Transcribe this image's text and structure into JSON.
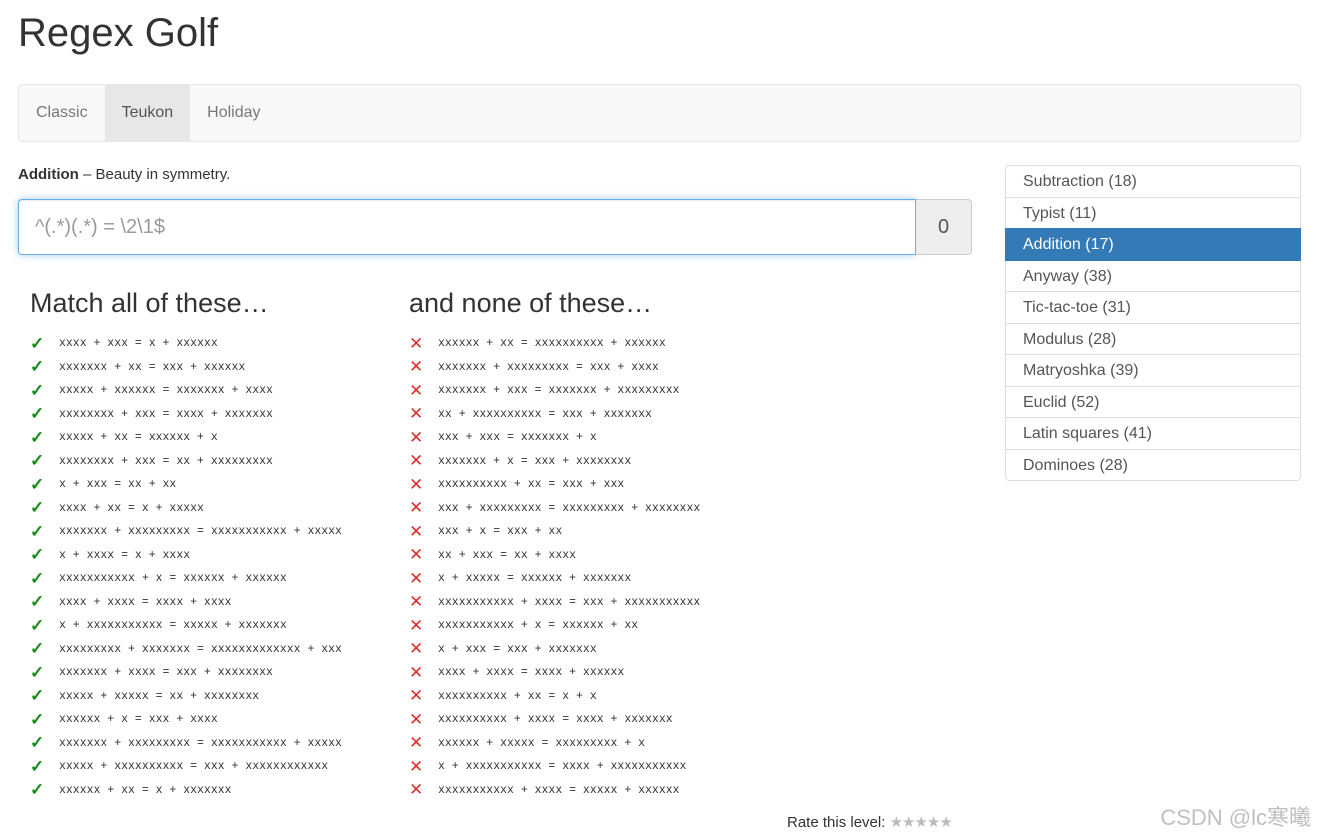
{
  "page": {
    "title": "Regex Golf"
  },
  "nav": {
    "tabs": [
      "Classic",
      "Teukon",
      "Holiday"
    ],
    "active": "Teukon"
  },
  "level": {
    "name": "Addition",
    "separator": " – ",
    "description": "Beauty in symmetry."
  },
  "input": {
    "value": "",
    "placeholder": "^(.*)(.*) = \\2\\1$"
  },
  "score": "0",
  "match": {
    "heading": "Match all of these…",
    "items": [
      "xxxx + xxx = x + xxxxxx",
      "xxxxxxx + xx = xxx + xxxxxx",
      "xxxxx + xxxxxx = xxxxxxx + xxxx",
      "xxxxxxxx + xxx = xxxx + xxxxxxx",
      "xxxxx + xx = xxxxxx + x",
      "xxxxxxxx + xxx = xx + xxxxxxxxx",
      "x + xxx = xx + xx",
      "xxxx + xx = x + xxxxx",
      "xxxxxxx + xxxxxxxxx = xxxxxxxxxxx + xxxxx",
      "x + xxxx = x + xxxx",
      "xxxxxxxxxxx + x = xxxxxx + xxxxxx",
      "xxxx + xxxx = xxxx + xxxx",
      "x + xxxxxxxxxxx = xxxxx + xxxxxxx",
      "xxxxxxxxx + xxxxxxx = xxxxxxxxxxxxx + xxx",
      "xxxxxxx + xxxx = xxx + xxxxxxxx",
      "xxxxx + xxxxx = xx + xxxxxxxx",
      "xxxxxx + x = xxx + xxxx",
      "xxxxxxx + xxxxxxxxx = xxxxxxxxxxx + xxxxx",
      "xxxxx + xxxxxxxxxx = xxx + xxxxxxxxxxxx",
      "xxxxxx + xx = x + xxxxxxx"
    ]
  },
  "nomatch": {
    "heading": "and none of these…",
    "items": [
      "xxxxxx + xx = xxxxxxxxxx + xxxxxx",
      "xxxxxxx + xxxxxxxxx = xxx + xxxx",
      "xxxxxxx + xxx = xxxxxxx + xxxxxxxxx",
      "xx + xxxxxxxxxx = xxx + xxxxxxx",
      "xxx + xxx = xxxxxxx + x",
      "xxxxxxx + x = xxx + xxxxxxxx",
      "xxxxxxxxxx + xx = xxx + xxx",
      "xxx + xxxxxxxxx = xxxxxxxxx + xxxxxxxx",
      "xxx + x = xxx + xx",
      "xx + xxx = xx + xxxx",
      "x + xxxxx = xxxxxx + xxxxxxx",
      "xxxxxxxxxxx + xxxx = xxx + xxxxxxxxxxx",
      "xxxxxxxxxxx + x = xxxxxx + xx",
      "x + xxx = xxx + xxxxxxx",
      "xxxx + xxxx = xxxx + xxxxxx",
      "xxxxxxxxxx + xx = x + x",
      "xxxxxxxxxx + xxxx = xxxx + xxxxxxx",
      "xxxxxx + xxxxx = xxxxxxxxx + x",
      "x + xxxxxxxxxxx = xxxx + xxxxxxxxxxx",
      "xxxxxxxxxxx + xxxx = xxxxx + xxxxxx"
    ]
  },
  "levels": [
    {
      "label": "Subtraction (18)",
      "active": false
    },
    {
      "label": "Typist (11)",
      "active": false
    },
    {
      "label": "Addition (17)",
      "active": true
    },
    {
      "label": "Anyway (38)",
      "active": false
    },
    {
      "label": "Tic-tac-toe (31)",
      "active": false
    },
    {
      "label": "Modulus (28)",
      "active": false
    },
    {
      "label": "Matryoshka (39)",
      "active": false
    },
    {
      "label": "Euclid (52)",
      "active": false
    },
    {
      "label": "Latin squares (41)",
      "active": false
    },
    {
      "label": "Dominoes (28)",
      "active": false
    }
  ],
  "rating": {
    "label": "Rate this level:",
    "stars": "★★★★★"
  },
  "watermark": "CSDN @lc寒曦",
  "icons": {
    "match": "check-icon",
    "nomatch": "cross-icon"
  },
  "colors": {
    "accent": "#337ab7",
    "check": "#1a8a1a",
    "cross": "#d9302f",
    "focus": "#66afe9"
  }
}
